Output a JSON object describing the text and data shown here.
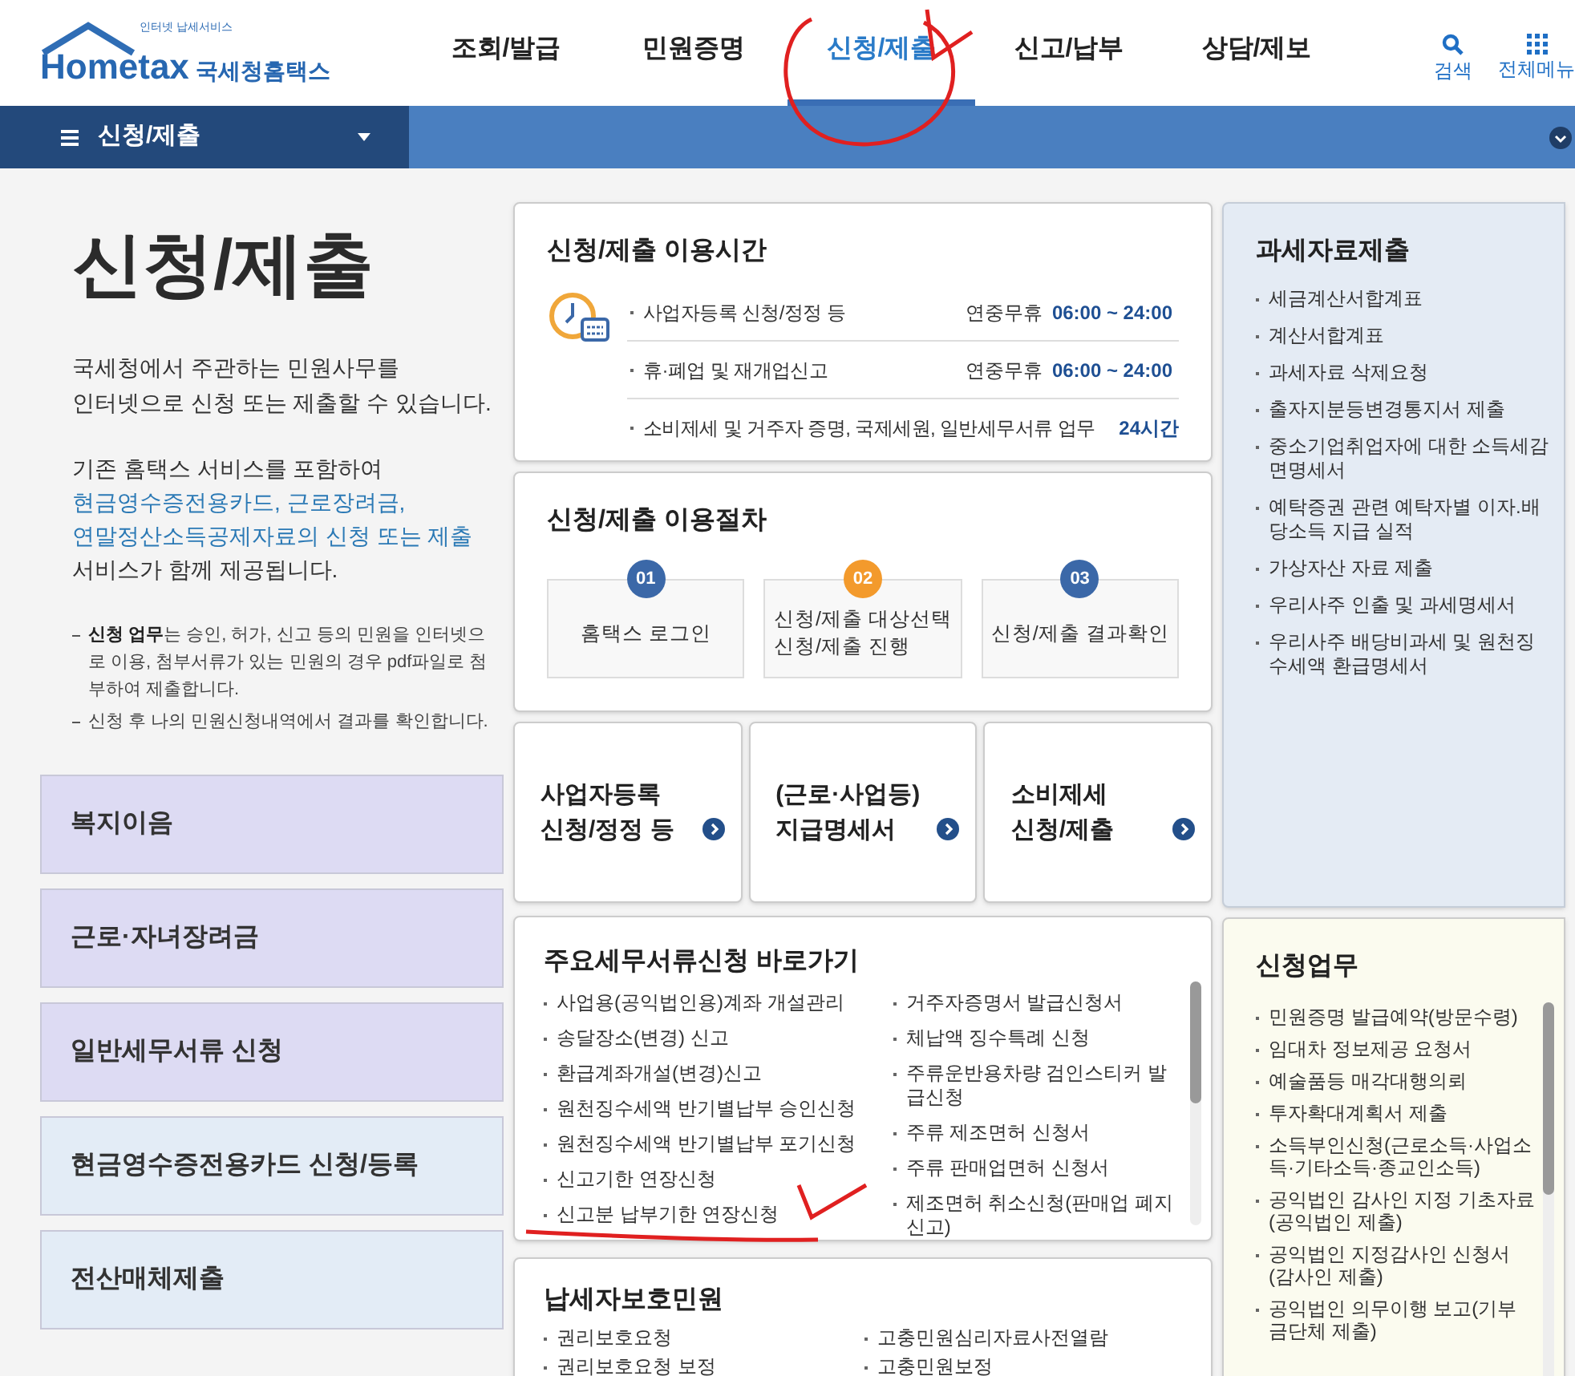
{
  "header": {
    "logo": {
      "tagline": "인터넷 납세서비스",
      "brand": "Hometax",
      "org": "국세청홈택스"
    },
    "nav": [
      {
        "label": "조회/발급",
        "selected": false
      },
      {
        "label": "민원증명",
        "selected": false
      },
      {
        "label": "신청/제출",
        "selected": true
      },
      {
        "label": "신고/납부",
        "selected": false
      },
      {
        "label": "상담/제보",
        "selected": false
      }
    ],
    "tools": [
      {
        "kind": "search",
        "label": "검색"
      },
      {
        "kind": "menu",
        "label": "전체메뉴"
      }
    ]
  },
  "subnav": {
    "title": "신청/제출"
  },
  "intro": {
    "title": "신청/제출",
    "paragraph_1": [
      "국세청에서 주관하는 민원사무를",
      "인터넷으로 신청 또는 제출할 수 있습니다."
    ],
    "paragraph_2": {
      "text": "기존 홈택스 서비스를 포함하여",
      "links": [
        "현금영수증전용카드, 근로장려금,",
        "연말정산소득공제자료의 신청 또는 제출"
      ],
      "tail": "서비스가 함께 제공됩니다."
    },
    "notes": [
      "**신청 업무**는 승인, 허가, 신고 등의 민원을 인터넷으로 이용, 첨부서류가 있는 민원의 경우 pdf파일로 첨부하여 제출합니다.",
      "신청 후 나의 민원신청내역에서 결과를 확인합니다."
    ]
  },
  "left_menu": [
    {
      "label": "복지이음",
      "color": "#dddbf3"
    },
    {
      "label": "근로·자녀장려금",
      "color": "#dddbf3"
    },
    {
      "label": "일반세무서류 신청",
      "color": "#dddbf3"
    },
    {
      "label": "현금영수증전용카드 신청/등록",
      "color": "#e3ecf6"
    },
    {
      "label": "전산매체제출",
      "color": "#e3ecf6"
    }
  ],
  "hours": {
    "title": "신청/제출 이용시간",
    "rows": [
      {
        "kind": "daily",
        "label": "사업자등록 신청/정정 등",
        "note": "연중무휴",
        "time": "06:00 ~ 24:00"
      },
      {
        "kind": "daily",
        "label": "휴·폐업 및 재개업신고",
        "note": "연중무휴",
        "time": "06:00 ~ 24:00"
      },
      {
        "kind": "allday",
        "label": "소비제세 및 거주자 증명, 국제세원, 일반세무서류 업무",
        "time": "24시간"
      }
    ]
  },
  "procedure": {
    "title": "신청/제출 이용절차",
    "steps": [
      {
        "number": "01",
        "color": "#3b68a8",
        "lines": [
          "홈택스 로그인"
        ]
      },
      {
        "number": "02",
        "color": "#f39a2c",
        "lines": [
          "신청/제출 대상선택",
          "신청/제출 진행"
        ]
      },
      {
        "number": "03",
        "color": "#3b68a8",
        "lines": [
          "신청/제출 결과확인"
        ]
      }
    ]
  },
  "tiles": [
    {
      "lines": [
        "사업자등록",
        "신청/정정 등"
      ]
    },
    {
      "lines": [
        "(근로·사업등)",
        "지급명세서"
      ]
    },
    {
      "lines": [
        "소비제세",
        "신청/제출"
      ]
    }
  ],
  "shortcuts": {
    "title": "주요세무서류신청 바로가기",
    "left": [
      "사업용(공익법인용)계좌 개설관리",
      "송달장소(변경) 신고",
      "환급계좌개설(변경)신고",
      "원천징수세액 반기별납부 승인신청",
      "원천징수세액 반기별납부 포기신청",
      "신고기한 연장신청",
      "신고분 납부기한 연장신청"
    ],
    "right": [
      "거주자증명서 발급신청서",
      "체납액 징수특례 신청",
      "주류운반용차량 검인스티커 발급신청",
      "주류 제조면허 신청서",
      "주류 판매업면허 신청서",
      "제조면허 취소신청(판매업 폐지신고)"
    ]
  },
  "protection": {
    "title": "납세자보호민원",
    "left": [
      "권리보호요청",
      "권리보호요청 보정"
    ],
    "right": [
      "고충민원심리자료사전열람",
      "고충민원보정"
    ]
  },
  "submission": {
    "title": "과세자료제출",
    "items": [
      "세금계산서합계표",
      "계산서합계표",
      "과세자료 삭제요청",
      "출자지분등변경통지서 제출",
      "중소기업취업자에 대한 소득세감면명세서",
      "예탁증권 관련 예탁자별 이자.배당소득 지급 실적",
      "가상자산 자료 제출",
      "우리사주 인출 및 과세명세서",
      "우리사주 배당비과세 및 원천징수세액 환급명세서"
    ]
  },
  "apply": {
    "title": "신청업무",
    "items": [
      "민원증명 발급예약(방문수령)",
      "임대차 정보제공 요청서",
      "예술품등 매각대행의뢰",
      "투자확대계획서 제출",
      "소득부인신청(근로소득·사업소득·기타소득·종교인소득)",
      "공익법인 감사인 지정 기초자료(공익법인 제출)",
      "공익법인 지정감사인 신청서(감사인 제출)",
      "공익법인 의무이행 보고(기부금단체 제출)"
    ]
  }
}
